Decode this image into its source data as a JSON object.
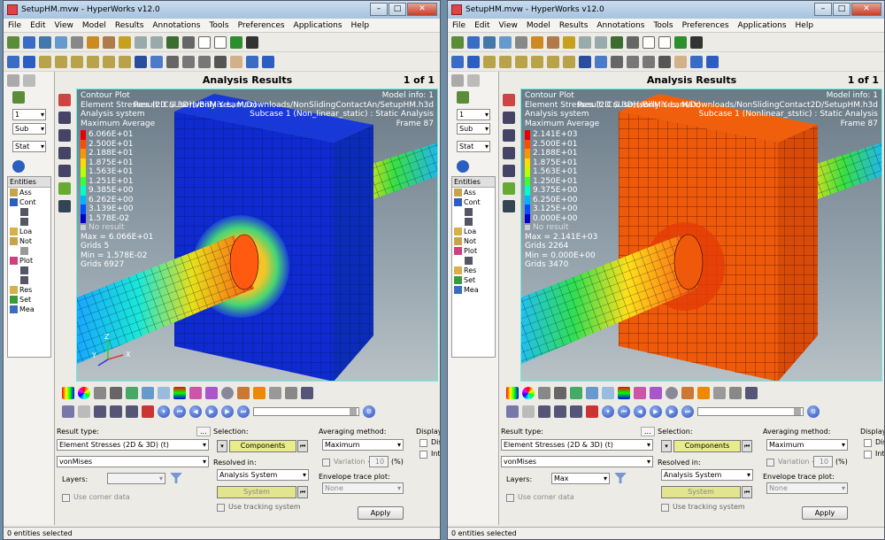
{
  "windows": [
    {
      "title": "SetupHM.mvw - HyperWorks v12.0",
      "menu": [
        "File",
        "Edit",
        "View",
        "Model",
        "Results",
        "Annotations",
        "Tools",
        "Preferences",
        "Applications",
        "Help"
      ],
      "panel_title": "Analysis Results",
      "page": "1 of 1",
      "overlay": {
        "l1": "Contour Plot",
        "l2": "Element Stresses (2D & 3D)(vonMises, Max)",
        "l3": "Analysis system",
        "l4": "Maximum Average",
        "r1": "Model info: 1",
        "r2": "Result: C:/Users/Billy Y. Lam/Downloads/NonSlidingContactAn/SetupHM.h3d",
        "r3": "Subcase 1 (Non_linear_static) : Static Analysis",
        "r4": "Frame 87"
      },
      "legend": [
        "6.066E+01",
        "2.500E+01",
        "2.188E+01",
        "1.875E+01",
        "1.563E+01",
        "1.251E+01",
        "9.385E+00",
        "6.262E+00",
        "3.139E+00",
        "1.578E-02"
      ],
      "no_result": "No result",
      "stats": [
        "Max = 6.066E+01",
        "Grids 5",
        "Min = 1.578E-02",
        "Grids 6927"
      ],
      "entities_header": "Entities",
      "entities": [
        "Ass",
        "Cont",
        "",
        "",
        "Loa",
        "Not",
        "",
        "Plot",
        "",
        "",
        "Res",
        "Set",
        "Mea"
      ],
      "left_combos": [
        "1",
        "Sub",
        "Stat"
      ],
      "form": {
        "result_type_label": "Result type:",
        "result_type": "Element Stresses (2D & 3D) (t)",
        "component": "vonMises",
        "layers_label": "Layers:",
        "layers_value": "",
        "corner_data": "Use corner data",
        "selection_label": "Selection:",
        "components_btn": "Components",
        "resolved_label": "Resolved in:",
        "resolved_value": "Analysis System",
        "system_btn": "System",
        "tracking": "Use tracking system",
        "averaging_label": "Averaging method:",
        "averaging_value": "Maximum",
        "variation": "Variation <",
        "variation_value": "10",
        "variation_unit": "(%)",
        "envelope_label": "Envelope trace plot:",
        "envelope_value": "None",
        "apply": "Apply",
        "display_label": "Display",
        "dis": "Dis",
        "int": "Int",
        "dots": "..."
      },
      "status": "0 entities selected"
    },
    {
      "title": "SetupHM.mvw - HyperWorks v12.0",
      "menu": [
        "File",
        "Edit",
        "View",
        "Model",
        "Results",
        "Annotations",
        "Tools",
        "Preferences",
        "Applications",
        "Help"
      ],
      "panel_title": "Analysis Results",
      "page": "1 of 1",
      "overlay": {
        "l1": "Contour Plot",
        "l2": "Element Stresses (2D & 3D)(vonMises, Max)",
        "l3": "Analysis system",
        "l4": "Maximum Average",
        "r1": "Model info: 1",
        "r2": "Result: C:/Users/Billy Y. Lam/Downloads/NonSlidingContact2D/SetupHM.h3d",
        "r3": "Subcase 1 (Nonlinear_ststic) : Static Analysis",
        "r4": "Frame 87"
      },
      "legend": [
        "2.141E+03",
        "2.500E+01",
        "2.188E+01",
        "1.875E+01",
        "1.563E+01",
        "1.250E+01",
        "9.375E+00",
        "6.250E+00",
        "3.125E+00",
        "0.000E+00"
      ],
      "no_result": "No result",
      "stats": [
        "Max = 2.141E+03",
        "Grids 2264",
        "Min = 0.000E+00",
        "Grids 3470"
      ],
      "entities_header": "Entities",
      "entities": [
        "Ass",
        "Cont",
        "",
        "",
        "Loa",
        "Not",
        "Plot",
        "",
        "Res",
        "Set",
        "Mea"
      ],
      "left_combos": [
        "1",
        "Sub",
        "Stat"
      ],
      "form": {
        "result_type_label": "Result type:",
        "result_type": "Element Stresses (2D & 3D) (t)",
        "component": "vonMises",
        "layers_label": "Layers:",
        "layers_value": "Max",
        "corner_data": "Use corner data",
        "selection_label": "Selection:",
        "components_btn": "Components",
        "resolved_label": "Resolved in:",
        "resolved_value": "Analysis System",
        "system_btn": "System",
        "tracking": "Use tracking system",
        "averaging_label": "Averaging method:",
        "averaging_value": "Maximum",
        "variation": "Variation <",
        "variation_value": "10",
        "variation_unit": "(%)",
        "envelope_label": "Envelope trace plot:",
        "envelope_value": "None",
        "apply": "Apply",
        "display_label": "Display",
        "dis": "Dis",
        "int": "Int",
        "dots": "..."
      },
      "status": "0 entities selected"
    }
  ],
  "legend_colors": [
    "#e60000",
    "#ff4a00",
    "#ff9400",
    "#ffdc00",
    "#b8ff00",
    "#38ff38",
    "#00ffc8",
    "#00b4ff",
    "#0050ff",
    "#0000c8"
  ],
  "axis": {
    "x": "X",
    "y": "Y",
    "z": "Z"
  }
}
